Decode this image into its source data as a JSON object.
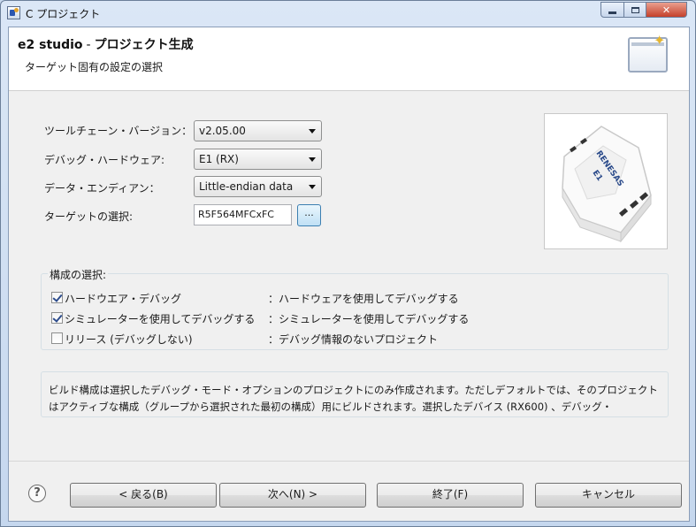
{
  "window": {
    "title": "C プロジェクト"
  },
  "banner": {
    "app_name": "e2 studio",
    "separator": "-",
    "page_title": "プロジェクト生成",
    "subtitle": "ターゲット固有の設定の選択"
  },
  "form": {
    "toolchain_label": "ツールチェーン・バージョン：",
    "toolchain_value": "v2.05.00",
    "debug_hw_label": "デバッグ・ハードウェア:",
    "debug_hw_value": "E1 (RX)",
    "endian_label": "データ・エンディアン：",
    "endian_value": "Little-endian data",
    "target_label": "ターゲットの選択:",
    "target_value": "R5F564MFCxFC",
    "browse_label": "..."
  },
  "device_photo": {
    "brand": "RENESAS",
    "model": "E1"
  },
  "config": {
    "legend": "構成の選択:",
    "items": [
      {
        "label": "ハードウエア・デバッグ",
        "desc": "：ハードウェアを使用してデバッグする",
        "checked": true
      },
      {
        "label": "シミュレーターを使用してデバッグする",
        "desc": "：シミュレーターを使用してデバッグする",
        "checked": true
      },
      {
        "label": "リリース (デバッグしない)",
        "desc": "：デバッグ情報のないプロジェクト",
        "checked": false
      }
    ]
  },
  "info": {
    "text": "ビルド構成は選択したデバッグ・モード・オプションのプロジェクトにのみ作成されます。ただしデフォルトでは、そのプロジェクトはアクティブな構成（グループから選択された最初の構成）用にビルドされます。選択したデバイス (RX600) 、デバッグ・"
  },
  "buttons": {
    "help": "?",
    "back": "< 戻る(B)",
    "next": "次へ(N) >",
    "finish": "終了(F)",
    "cancel": "キャンセル"
  },
  "icons": {
    "app": "c-project-icon",
    "wizard": "new-project-wizard-icon",
    "help": "help-icon"
  }
}
